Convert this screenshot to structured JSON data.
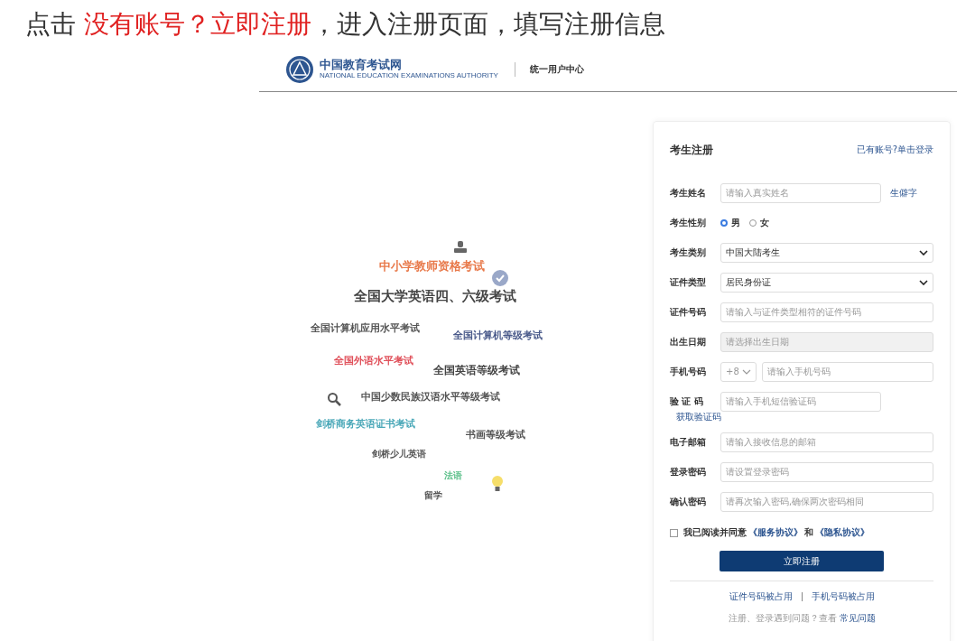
{
  "heading": [
    {
      "text": "点击 ",
      "highlight": false
    },
    {
      "text": "没有账号？立即注册",
      "highlight": true
    },
    {
      "text": "，进入注册页面，填写注册信息",
      "highlight": false
    }
  ],
  "header": {
    "logo_title": "中国教育考试网",
    "logo_subtitle": "NATIONAL EDUCATION EXAMINATIONS AUTHORITY",
    "portal": "统一用户中心"
  },
  "illustration_words": [
    {
      "text": "中小学教师资格考试",
      "color": "#e8794a"
    },
    {
      "text": "全国大学英语四、六级考试",
      "color": "#444444"
    },
    {
      "text": "全国计算机应用水平考试",
      "color": "#555555"
    },
    {
      "text": "全国计算机等级考试",
      "color": "#4a5a8a"
    },
    {
      "text": "全国外语水平考试",
      "color": "#e0505a"
    },
    {
      "text": "全国英语等级考试",
      "color": "#444444"
    },
    {
      "text": "中国少数民族汉语水平等级考试",
      "color": "#555555"
    },
    {
      "text": "剑桥商务英语证书考试",
      "color": "#4aa8b8"
    },
    {
      "text": "书画等级考试",
      "color": "#555555"
    },
    {
      "text": "剑桥少儿英语",
      "color": "#555555"
    },
    {
      "text": "法语",
      "color": "#5cc08a"
    },
    {
      "text": "留学",
      "color": "#555555"
    }
  ],
  "form": {
    "title": "考生注册",
    "login_link": "已有账号?单击登录",
    "fields": [
      {
        "kind": "text",
        "label": "考生姓名",
        "placeholder": "请输入真实姓名",
        "aside": "生僻字"
      },
      {
        "kind": "radio",
        "label": "考生性别",
        "options": [
          {
            "label": "男",
            "selected": true
          },
          {
            "label": "女",
            "selected": false
          }
        ]
      },
      {
        "kind": "select",
        "label": "考生类别",
        "value": "中国大陆考生"
      },
      {
        "kind": "select",
        "label": "证件类型",
        "value": "居民身份证"
      },
      {
        "kind": "text",
        "label": "证件号码",
        "placeholder": "请输入与证件类型相符的证件号码"
      },
      {
        "kind": "text",
        "label": "出生日期",
        "placeholder": "请选择出生日期",
        "disabled": true
      },
      {
        "kind": "phone",
        "label": "手机号码",
        "prefix": "+8",
        "placeholder": "请输入手机号码"
      },
      {
        "kind": "code",
        "label": "验 证 码",
        "placeholder": "请输入手机短信验证码",
        "link": "获取验证码"
      },
      {
        "kind": "text",
        "label": "电子邮箱",
        "placeholder": "请输入接收信息的邮箱"
      },
      {
        "kind": "text",
        "label": "登录密码",
        "placeholder": "请设置登录密码"
      },
      {
        "kind": "text",
        "label": "确认密码",
        "placeholder": "请再次输入密码,确保两次密码相同"
      }
    ],
    "agreement": {
      "checked": false,
      "text": "我已阅读并同意",
      "link1": "《服务协议》",
      "joiner": "和",
      "link2": "《隐私协议》"
    },
    "submit": "立即注册",
    "bottom_links": [
      "证件号码被占用",
      "手机号码被占用"
    ],
    "help_text": "注册、登录遇到问题？查看",
    "help_link": "常见问题"
  }
}
